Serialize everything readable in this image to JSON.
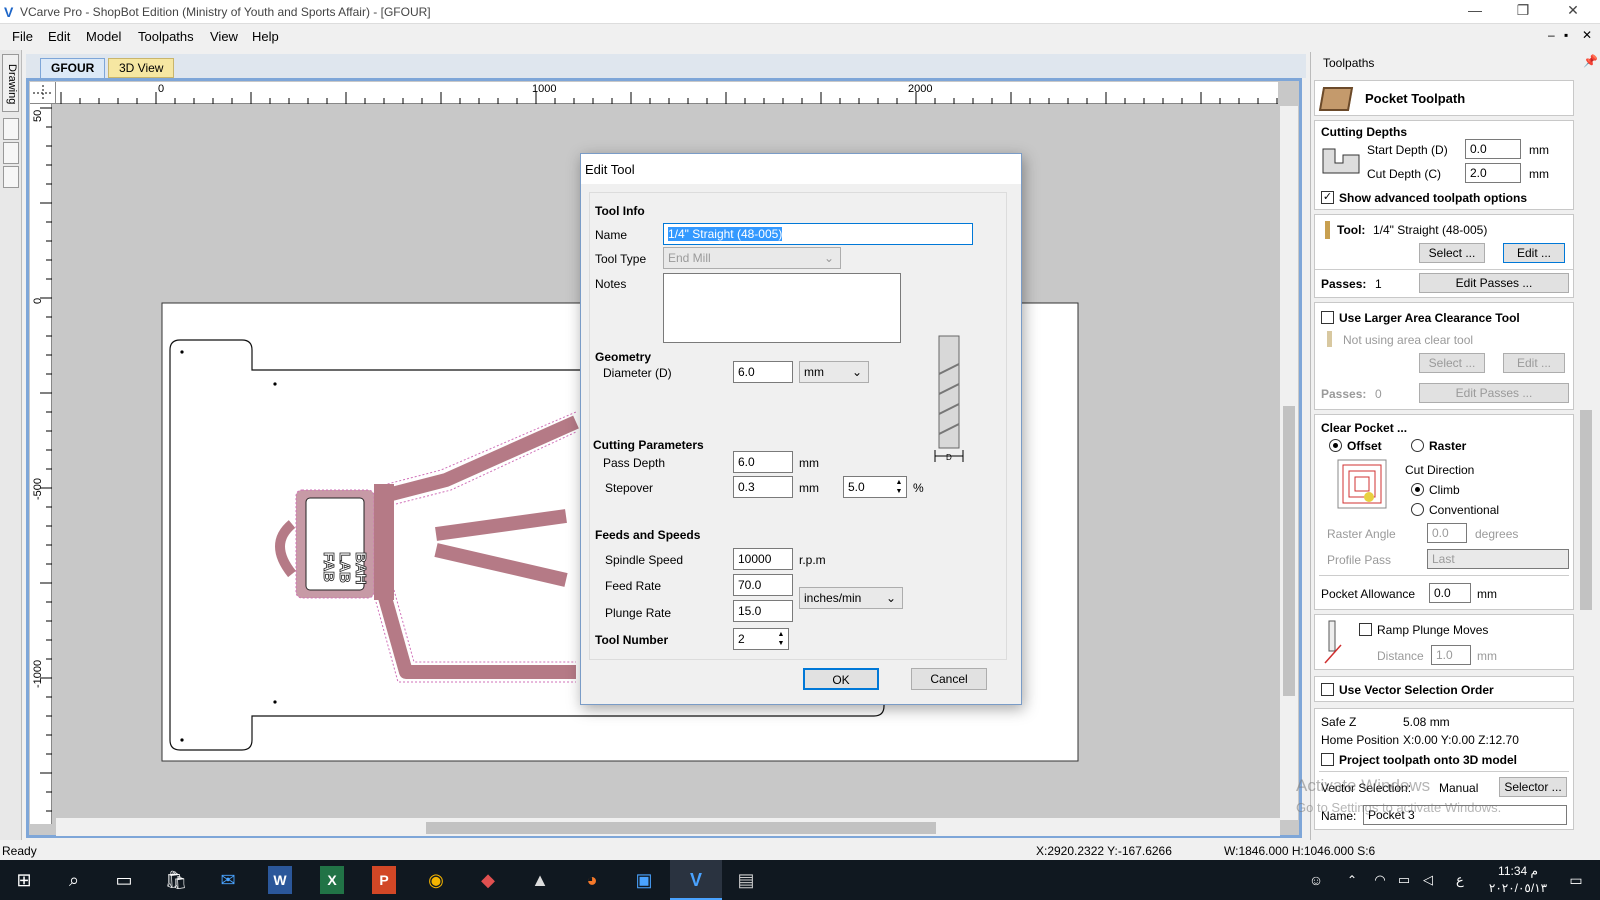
{
  "window": {
    "title": "VCarve Pro - ShopBot Edition (Ministry of Youth and Sports Affair) - [GFOUR]",
    "minimize": "—",
    "restore": "❐",
    "close": "✕"
  },
  "menu": {
    "items": [
      "File",
      "Edit",
      "Model",
      "Toolpaths",
      "View",
      "Help"
    ]
  },
  "mdi": {
    "min": "–",
    "restore": "▪",
    "close": "✕"
  },
  "side_tab": "Drawing",
  "tabs": [
    {
      "label": "GFOUR"
    },
    {
      "label": "3D View"
    }
  ],
  "ruler": {
    "top": [
      "0",
      "1000",
      "2000"
    ],
    "left": [
      "50",
      "0",
      "-500",
      "-1000"
    ]
  },
  "design_text": [
    "FAB",
    "LAB",
    "BAH"
  ],
  "status": {
    "left": "Ready",
    "coords": "X:2920.2322 Y:-167.6266",
    "dims": "W:1846.000  H:1046.000  S:6"
  },
  "watermark": {
    "line1": "Activate Windows",
    "line2": "Go to Settings to activate Windows."
  },
  "panel": {
    "title": "Toolpaths",
    "header": "Pocket Toolpath",
    "cutting_depths": {
      "label": "Cutting Depths",
      "start_label": "Start Depth (D)",
      "start_value": "0.0",
      "cut_label": "Cut Depth (C)",
      "cut_value": "2.0",
      "unit": "mm"
    },
    "advanced": "Show advanced toolpath options",
    "tool": {
      "label": "Tool:",
      "name": "1/4\" Straight  (48-005)",
      "select": "Select ...",
      "edit": "Edit ..."
    },
    "passes": {
      "label": "Passes:",
      "value": "1",
      "button": "Edit Passes ..."
    },
    "clearance": {
      "label": "Use Larger Area Clearance Tool",
      "status": "Not using area clear tool",
      "select": "Select ...",
      "edit": "Edit ...",
      "passes_label": "Passes:",
      "passes_value": "0",
      "passes_button": "Edit Passes ..."
    },
    "clear_pocket": {
      "label": "Clear Pocket ...",
      "offset": "Offset",
      "raster": "Raster",
      "cut_direction": "Cut Direction",
      "climb": "Climb",
      "conventional": "Conventional",
      "raster_angle_label": "Raster Angle",
      "raster_angle": "0.0",
      "degrees": "degrees",
      "profile_pass_label": "Profile Pass",
      "profile_pass": "Last"
    },
    "pocket_allowance": {
      "label": "Pocket Allowance",
      "value": "0.0",
      "unit": "mm"
    },
    "ramp": {
      "label": "Ramp Plunge Moves",
      "distance_label": "Distance",
      "distance": "1.0",
      "unit": "mm"
    },
    "vector_order": "Use Vector Selection Order",
    "safe_z": {
      "label": "Safe Z",
      "value": "5.08 mm"
    },
    "home": {
      "label": "Home Position",
      "value": "X:0.00 Y:0.00 Z:12.70"
    },
    "project": "Project toolpath onto 3D model",
    "vector_selection": {
      "label": "Vector Selection:",
      "value": "Manual",
      "button": "Selector ..."
    },
    "name": {
      "label": "Name:",
      "value": "Pocket 3"
    }
  },
  "dialog": {
    "title": "Edit Tool",
    "tool_info": "Tool Info",
    "name_label": "Name",
    "name_value": "1/4\" Straight  (48-005)",
    "tool_type_label": "Tool Type",
    "tool_type": "End Mill",
    "notes_label": "Notes",
    "geometry": "Geometry",
    "diameter_label": "Diameter (D)",
    "diameter": "6.0",
    "diameter_unit": "mm",
    "cutting_params": "Cutting Parameters",
    "pass_depth_label": "Pass Depth",
    "pass_depth": "6.0",
    "mm": "mm",
    "stepover_label": "Stepover",
    "stepover": "0.3",
    "stepover_pct": "5.0",
    "pct": "%",
    "feeds": "Feeds and Speeds",
    "spindle_label": "Spindle Speed",
    "spindle": "10000",
    "rpm": "r.p.m",
    "feed_label": "Feed Rate",
    "feed": "70.0",
    "plunge_label": "Plunge Rate",
    "plunge": "15.0",
    "rate_unit": "inches/min",
    "tool_number_label": "Tool Number",
    "tool_number": "2",
    "ok": "OK",
    "cancel": "Cancel"
  },
  "taskbar": {
    "time": "11:34 م",
    "date": "٢٠٢٠/٠٥/١٣",
    "lang": "ع"
  }
}
